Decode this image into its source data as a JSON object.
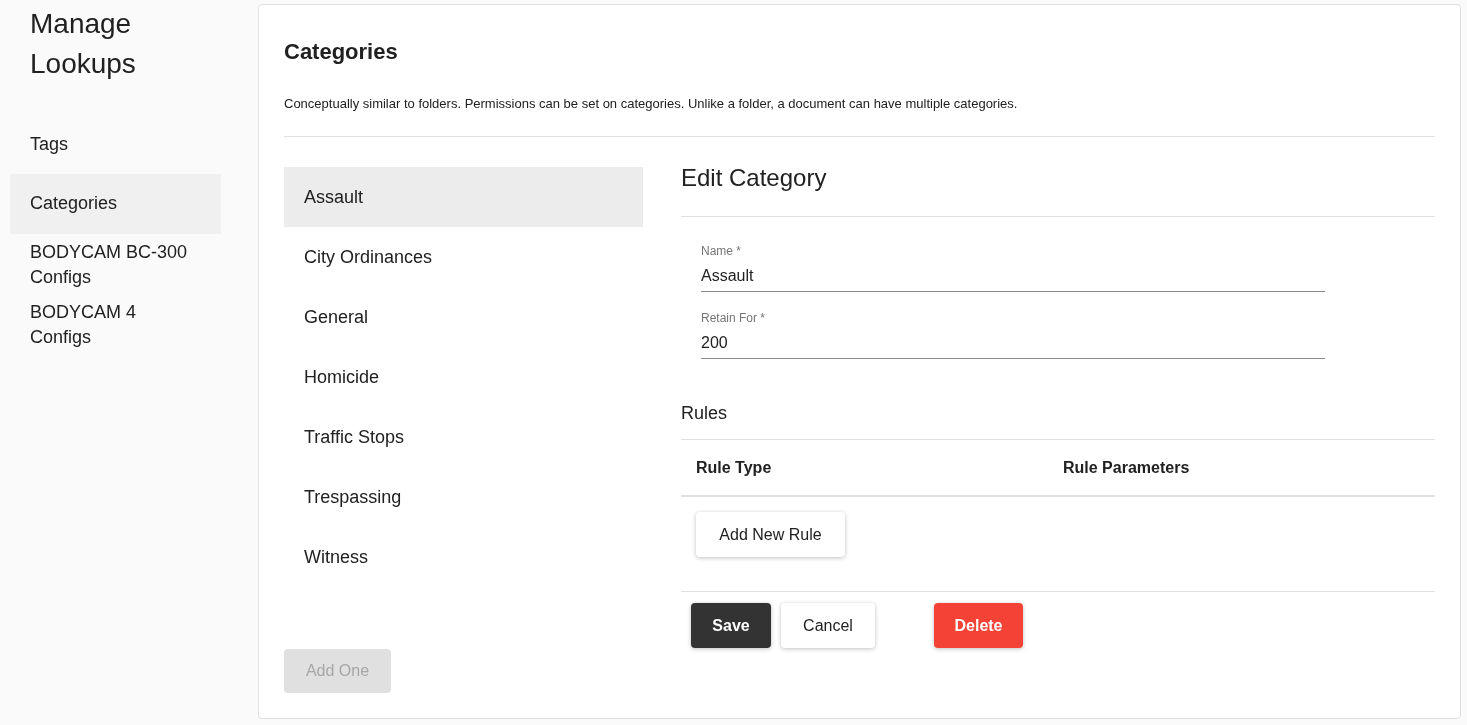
{
  "sidebar": {
    "title": "Manage Lookups",
    "items": [
      {
        "label": "Tags",
        "selected": false
      },
      {
        "label": "Categories",
        "selected": true
      },
      {
        "label": "BODYCAM BC-300 Configs",
        "selected": false
      },
      {
        "label": "BODYCAM 4 Configs",
        "selected": false
      }
    ]
  },
  "panel": {
    "title": "Categories",
    "description": "Conceptually similar to folders. Permissions can be set on categories. Unlike a folder, a document can have multiple categories.",
    "categories": [
      {
        "label": "Assault",
        "selected": true
      },
      {
        "label": "City Ordinances",
        "selected": false
      },
      {
        "label": "General",
        "selected": false
      },
      {
        "label": "Homicide",
        "selected": false
      },
      {
        "label": "Traffic Stops",
        "selected": false
      },
      {
        "label": "Trespassing",
        "selected": false
      },
      {
        "label": "Witness",
        "selected": false
      }
    ],
    "add_button": {
      "label": "Add One",
      "disabled": true
    }
  },
  "editor": {
    "title": "Edit Category",
    "fields": [
      {
        "label": "Name *",
        "value": "Assault"
      },
      {
        "label": "Retain For *",
        "value": "200"
      }
    ],
    "rules": {
      "title": "Rules",
      "columns": [
        "Rule Type",
        "Rule Parameters"
      ],
      "add_button": "Add New Rule"
    },
    "actions": [
      {
        "label": "Save",
        "kind": "primary"
      },
      {
        "label": "Cancel",
        "kind": "secondary"
      },
      {
        "label": "Delete",
        "kind": "danger"
      }
    ]
  }
}
